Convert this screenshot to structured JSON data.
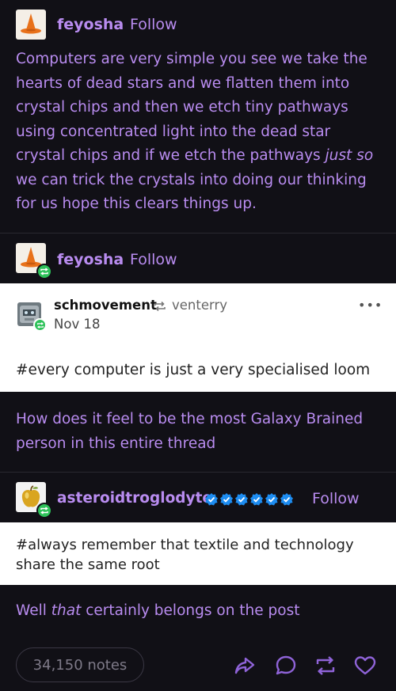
{
  "post1": {
    "username": "feyosha",
    "follow_label": "Follow",
    "body_parts": [
      "Computers are very simple you see we take the hearts of dead stars and we flatten them into crystal chips and then we etch tiny pathways using concentrated light into the dead star crystal chips and if we etch the pathways ",
      "just so",
      " we can trick the crystals into doing our thinking for us hope this clears things up."
    ]
  },
  "post2": {
    "username": "feyosha",
    "follow_label": "Follow"
  },
  "embedded": {
    "username": "schmovement",
    "reblogged_from": "venterry",
    "date": "Nov 18",
    "tag": "#every computer is just a very specialised loom",
    "more_label": "•••"
  },
  "post3": {
    "body": "How does it feel to be the most Galaxy Brained person in this entire thread"
  },
  "post4": {
    "username": "asteroidtroglodyte",
    "follow_label": "Follow",
    "tag": "#always remember that textile and technology share the same root"
  },
  "post5": {
    "body_before": "Well ",
    "body_em": "that",
    "body_after": " certainly belongs on the post"
  },
  "footer": {
    "notes": "34,150 notes"
  },
  "colors": {
    "accent": "#b98cf0",
    "background": "#111016",
    "reblog_green": "#2ec25a",
    "verified_blue": "#1d8cf0"
  },
  "icons": [
    "witch-hat-avatar",
    "robot-avatar",
    "golden-apple-avatar",
    "reblog-icon",
    "verified-check-icon",
    "share-icon",
    "reply-icon",
    "reblog-action-icon",
    "heart-icon",
    "more-icon"
  ]
}
